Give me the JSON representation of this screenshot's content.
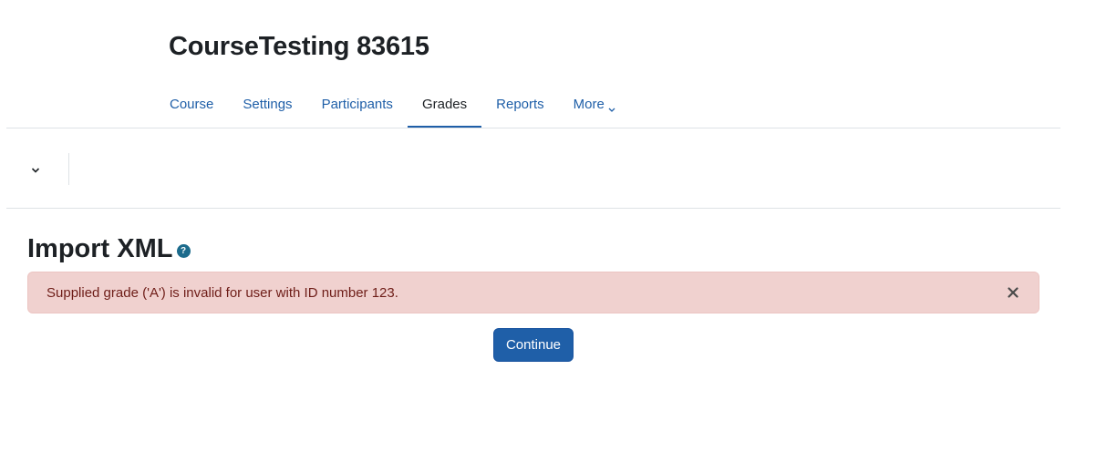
{
  "header": {
    "course_title": "CourseTesting 83615"
  },
  "nav": {
    "items": [
      {
        "label": "Course"
      },
      {
        "label": "Settings"
      },
      {
        "label": "Participants"
      },
      {
        "label": "Grades"
      },
      {
        "label": "Reports"
      },
      {
        "label": "More"
      }
    ],
    "active": "Grades"
  },
  "main": {
    "heading": "Import XML",
    "help_icon_glyph": "?",
    "alert": {
      "message": "Supplied grade ('A') is invalid for user with ID number 123.",
      "type": "error"
    },
    "continue_label": "Continue"
  },
  "icons": {
    "tertiary_toggle": "chevron-down-icon",
    "more_chevron": "chevron-down-icon",
    "help": "question-circle-icon",
    "alert_close": "close-icon"
  },
  "colors": {
    "link": "#1f5fa8",
    "alert_bg": "#f0d1cf",
    "alert_text": "#6e1d18",
    "primary_button": "#1f5fa8",
    "help_icon": "#1c6b8c"
  }
}
